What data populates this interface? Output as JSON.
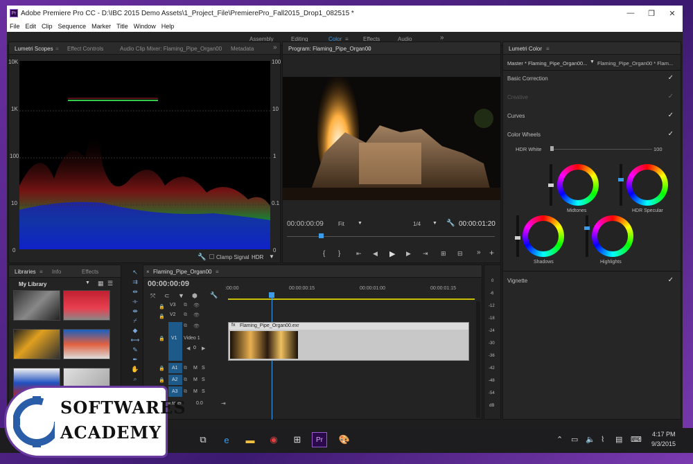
{
  "window": {
    "title": "Adobe Premiere Pro CC - D:\\IBC 2015 Demo Assets\\1_Project_File\\PremierePro_Fall2015_Drop1_082515 *",
    "app_icon": "Pr",
    "minimize": "—",
    "maximize": "❐",
    "close": "✕"
  },
  "menu": [
    "File",
    "Edit",
    "Clip",
    "Sequence",
    "Marker",
    "Title",
    "Window",
    "Help"
  ],
  "workspaces": {
    "items": [
      "Assembly",
      "Editing",
      "Color",
      "Effects",
      "Audio"
    ],
    "active": "Color",
    "more": "»"
  },
  "scopes_panel": {
    "tabs": [
      "Lumetri Scopes",
      "Effect Controls",
      "Audio Clip Mixer: Flaming_Pipe_Organ00",
      "Metadata"
    ],
    "more": "»",
    "left_axis": [
      "10K",
      "1K",
      "100",
      "10",
      "0"
    ],
    "right_axis": [
      "100",
      "10",
      "1",
      "0.1",
      "0"
    ],
    "clamp_label": "Clamp Signal",
    "hdr_label": "HDR"
  },
  "program": {
    "title": "Program: Flaming_Pipe_Organ00",
    "timecode": "00:00:00:09",
    "fit": "Fit",
    "resolution": "1/4",
    "duration": "00:00:01:20"
  },
  "lumetri_color": {
    "title": "Lumetri Color",
    "master": "Master * Flaming_Pipe_Organ00...",
    "clip": "Flaming_Pipe_Organ00 * Flam...",
    "sections": [
      "Basic Correction",
      "Creative",
      "Curves",
      "Color Wheels"
    ],
    "hdr_white_label": "HDR White",
    "hdr_white_value": "100",
    "wheels": [
      "Midtones",
      "HDR Specular",
      "Shadows",
      "Highlights"
    ],
    "vignette": "Vignette",
    "check": "✓"
  },
  "libraries": {
    "tabs": [
      "Libraries",
      "Info",
      "Effects"
    ],
    "library_name": "My Library"
  },
  "timeline": {
    "title": "Flaming_Pipe_Organ00",
    "timecode": "00:00:00:09",
    "ruler": [
      ":00:00",
      "00:00:00:15",
      "00:00:01:00",
      "00:00:01:15"
    ],
    "video_tracks": [
      "V3",
      "V2",
      "V1"
    ],
    "video1_label": "Video 1",
    "audio_tracks": [
      "A1",
      "A2",
      "A3"
    ],
    "master_label": "Master",
    "master_value": "0.0",
    "clip_name": "Flaming_Pipe_Organ00.exr",
    "track_value": "0",
    "audio_m": "M",
    "audio_s": "S"
  },
  "meter": {
    "scale": [
      "0",
      "-6",
      "-12",
      "-18",
      "-24",
      "-30",
      "-36",
      "-42",
      "-48",
      "-54",
      "dB"
    ]
  },
  "taskbar": {
    "time": "4:17 PM",
    "date": "9/3/2015"
  },
  "logo": {
    "line1": "SOFTWARES",
    "line2": "ACADEMY"
  }
}
